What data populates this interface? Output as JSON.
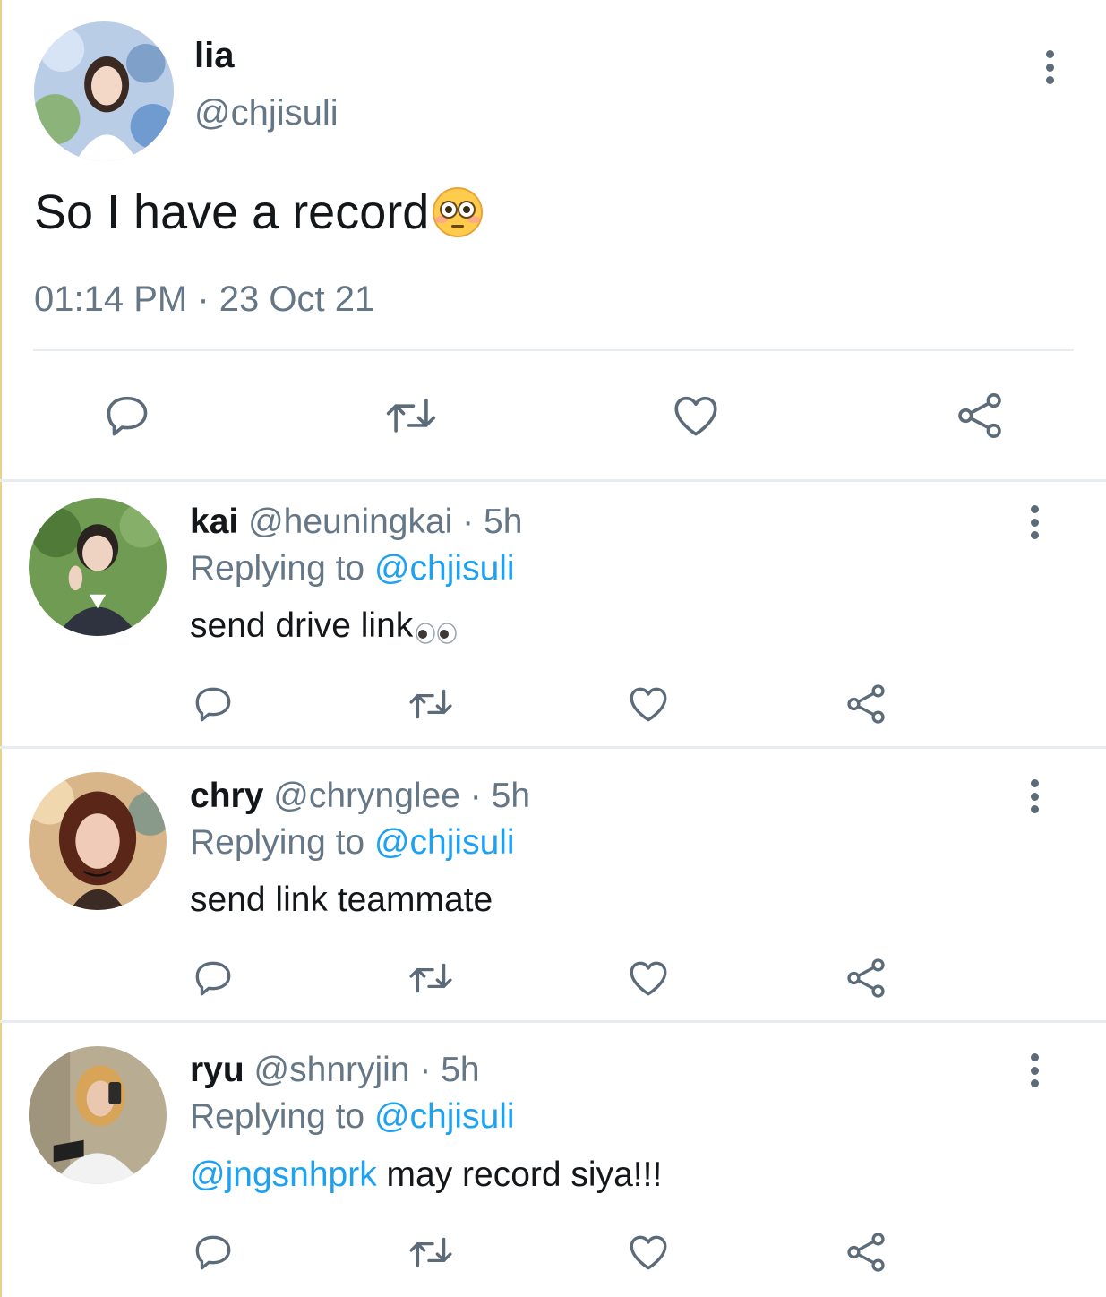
{
  "main_tweet": {
    "display_name": "lia",
    "handle": "@chjisuli",
    "text": "So I have a record",
    "text_emoji": "flushed-face-emoji",
    "timestamp": "01:14 PM · 23 Oct 21"
  },
  "actions": [
    "reply-icon",
    "retweet-icon",
    "like-icon",
    "share-icon"
  ],
  "replies": [
    {
      "display_name": "kai",
      "handle": "@heuningkai",
      "separator": "·",
      "time": "5h",
      "replying_label": "Replying to",
      "replying_to": "@chjisuli",
      "text_mention": "",
      "text": "send drive link",
      "text_emoji": "eyes-emoji"
    },
    {
      "display_name": "chry",
      "handle": "@chrynglee",
      "separator": "·",
      "time": "5h",
      "replying_label": "Replying to",
      "replying_to": "@chjisuli",
      "text_mention": "",
      "text": "send link teammate"
    },
    {
      "display_name": "ryu",
      "handle": "@shnryjin",
      "separator": "·",
      "time": "5h",
      "replying_label": "Replying to",
      "replying_to": "@chjisuli",
      "text_mention": "@jngsnhprk",
      "text": " may record siya!!!"
    }
  ],
  "colors": {
    "text": "#14171a",
    "secondary": "#657786",
    "link": "#1da1f2",
    "icon": "#5b6b79",
    "divider": "#e6ecf0"
  }
}
